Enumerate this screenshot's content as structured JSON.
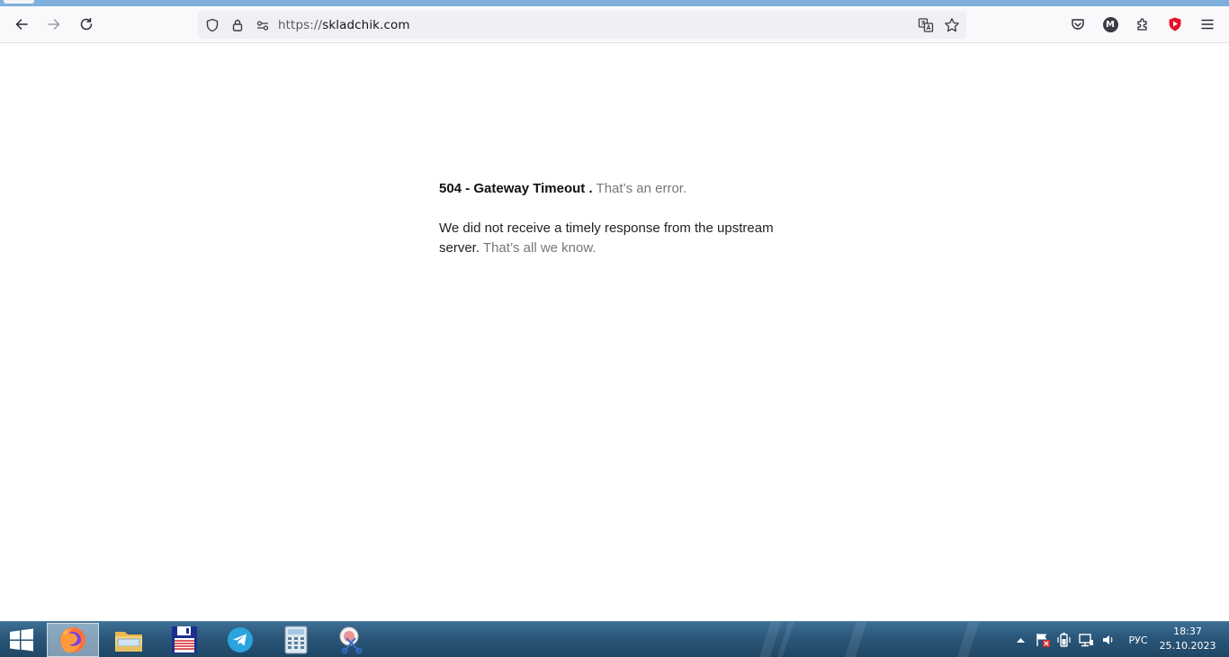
{
  "browser": {
    "url_scheme": "https://",
    "url_host": "skladchik.com",
    "profile_initial": "M"
  },
  "error_page": {
    "heading_bold": "504 - Gateway Timeout .",
    "heading_gray": "That’s an error.",
    "body_text": "We did not receive a timely response from the upstream server.",
    "body_gray": "That’s all we know."
  },
  "taskbar": {
    "apps": [
      "firefox-icon",
      "file-explorer-icon",
      "save-disk-icon",
      "telegram-icon",
      "calculator-icon",
      "snipping-tool-icon"
    ],
    "language": "РУС",
    "time": "18:37",
    "date": "25.10.2023"
  },
  "colors": {
    "taskbar": "#2a5679",
    "accent_strip": "#7fb0dc",
    "text_dark": "#222222",
    "text_gray": "#777777"
  }
}
